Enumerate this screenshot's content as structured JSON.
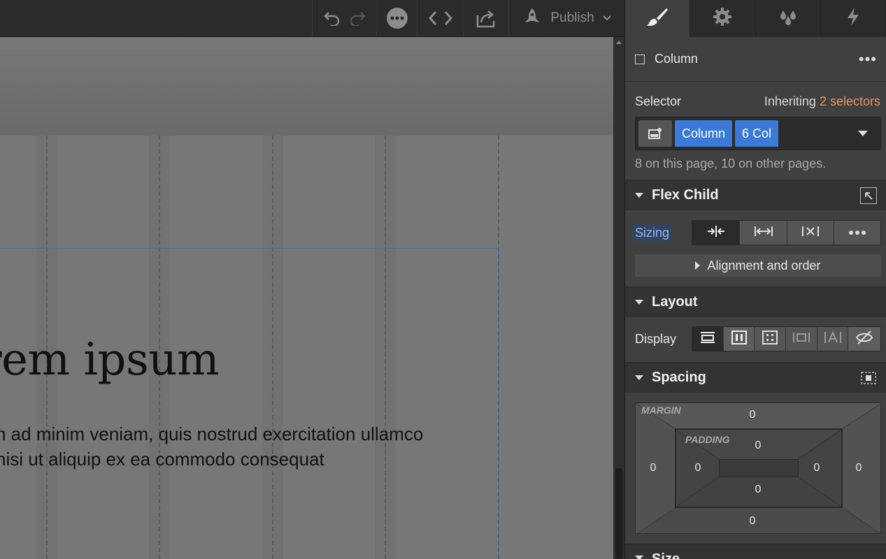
{
  "toolbar": {
    "publish_label": "Publish",
    "icons": [
      "undo-icon",
      "redo-icon",
      "more-icon",
      "code-icon",
      "export-icon",
      "rocket-icon"
    ]
  },
  "canvas": {
    "heading": "rem ipsum",
    "paragraph_line1": "n ad minim veniam, quis nostrud exercitation ullamco",
    "paragraph_line2": "nisi ut aliquip ex ea commodo consequat"
  },
  "panel": {
    "tabs": [
      "style",
      "settings",
      "interactions",
      "lightning"
    ],
    "element_name": "Column",
    "selector": {
      "label": "Selector",
      "inheriting_prefix": "Inheriting",
      "inheriting_link": "2 selectors",
      "chips": [
        "Column",
        "6 Col"
      ],
      "usage": "8 on this page, 10 on other pages."
    },
    "flex_child": {
      "title": "Flex Child",
      "sizing_label": "Sizing",
      "sizing_options": [
        "shrink",
        "grow",
        "none",
        "more"
      ],
      "sizing_selected": "shrink",
      "alignment_label": "Alignment and order"
    },
    "layout": {
      "title": "Layout",
      "display_label": "Display",
      "display_options": [
        "block",
        "flex",
        "grid",
        "inline-block",
        "inline",
        "none"
      ],
      "display_selected": "block"
    },
    "spacing": {
      "title": "Spacing",
      "margin_label": "MARGIN",
      "padding_label": "PADDING",
      "margin": {
        "top": "0",
        "right": "0",
        "bottom": "0",
        "left": "0"
      },
      "padding": {
        "top": "0",
        "right": "0",
        "bottom": "0",
        "left": "0"
      }
    },
    "size": {
      "title": "Size"
    }
  },
  "colors": {
    "accent_blue": "#3b7ad6",
    "link_orange": "#e8945b",
    "selection_blue": "#3e6fa6"
  }
}
